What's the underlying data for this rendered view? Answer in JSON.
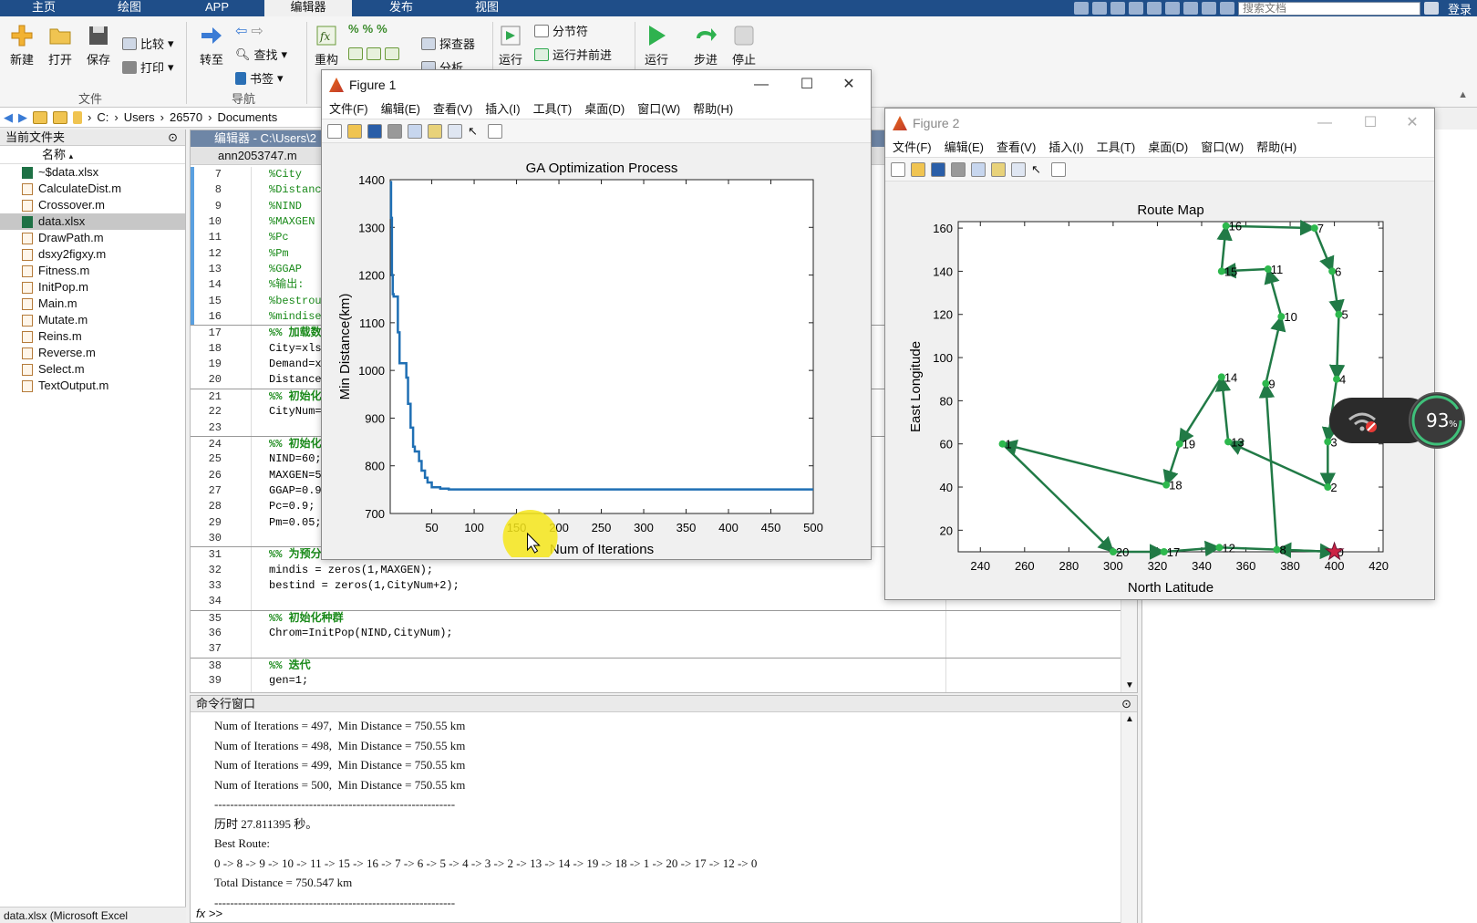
{
  "top_tabs": [
    {
      "label": "主页",
      "active": false
    },
    {
      "label": "绘图",
      "active": false
    },
    {
      "label": "APP",
      "active": false
    },
    {
      "label": "编辑器",
      "active": true
    },
    {
      "label": "发布",
      "active": false
    },
    {
      "label": "视图",
      "active": false
    }
  ],
  "search_placeholder": "搜索文档",
  "login_label": "登录",
  "ribbon": {
    "new_label": "新建",
    "open_label": "打开",
    "save_label": "保存",
    "compare_label": "比较",
    "print_label": "打印",
    "file_group": "文件",
    "goto_label": "转至",
    "find_label": "查找",
    "bookmark_label": "书签",
    "nav_group": "导航",
    "refactor_label": "重构",
    "analyzer_label": "探查器",
    "analyze_label": "分析",
    "run_section_label": "运行",
    "section_break_label": "分节符",
    "run_advance_label": "运行并前进",
    "run_label": "运行",
    "step_label": "步进",
    "stop_label": "停止"
  },
  "address": {
    "crumbs": [
      "C:",
      "Users",
      "26570",
      "Documents"
    ]
  },
  "file_panel": {
    "title": "当前文件夹",
    "col_name": "名称",
    "files": [
      {
        "name": "~$data.xlsx",
        "type": "xlsx",
        "selected": false
      },
      {
        "name": "CalculateDist.m",
        "type": "m",
        "selected": false
      },
      {
        "name": "Crossover.m",
        "type": "m",
        "selected": false
      },
      {
        "name": "data.xlsx",
        "type": "xlsx",
        "selected": true
      },
      {
        "name": "DrawPath.m",
        "type": "m",
        "selected": false
      },
      {
        "name": "dsxy2figxy.m",
        "type": "m",
        "selected": false
      },
      {
        "name": "Fitness.m",
        "type": "m",
        "selected": false
      },
      {
        "name": "InitPop.m",
        "type": "m",
        "selected": false
      },
      {
        "name": "Main.m",
        "type": "m",
        "selected": false
      },
      {
        "name": "Mutate.m",
        "type": "m",
        "selected": false
      },
      {
        "name": "Reins.m",
        "type": "m",
        "selected": false
      },
      {
        "name": "Reverse.m",
        "type": "m",
        "selected": false
      },
      {
        "name": "Select.m",
        "type": "m",
        "selected": false
      },
      {
        "name": "TextOutput.m",
        "type": "m",
        "selected": false
      }
    ],
    "bottom_label": "data.xlsx (Microsoft Excel"
  },
  "editor": {
    "title": "编辑器 - C:\\Users\\2",
    "tab": "ann2053747.m",
    "lines": [
      {
        "n": "7",
        "text": "%City",
        "kind": "c",
        "bar": true
      },
      {
        "n": "8",
        "text": "%Distanc",
        "kind": "c",
        "bar": true
      },
      {
        "n": "9",
        "text": "%NIND",
        "kind": "c",
        "bar": true
      },
      {
        "n": "10",
        "text": "%MAXGEN",
        "kind": "c",
        "bar": true
      },
      {
        "n": "11",
        "text": "%Pc",
        "kind": "c",
        "bar": true
      },
      {
        "n": "12",
        "text": "%Pm",
        "kind": "c",
        "bar": true
      },
      {
        "n": "13",
        "text": "%GGAP",
        "kind": "c",
        "bar": true
      },
      {
        "n": "14",
        "text": "%输出:",
        "kind": "c",
        "bar": true
      },
      {
        "n": "15",
        "text": "%bestrou",
        "kind": "c",
        "bar": true
      },
      {
        "n": "16",
        "text": "%mindise",
        "kind": "c",
        "bar": true
      },
      {
        "n": "17",
        "text": "%% 加载数",
        "kind": "s",
        "bar": false,
        "brk": true
      },
      {
        "n": "18",
        "text": "City=xls",
        "kind": "x",
        "bar": false
      },
      {
        "n": "19",
        "text": "Demand=x",
        "kind": "x",
        "bar": false
      },
      {
        "n": "20",
        "text": "Distance",
        "kind": "x",
        "bar": false
      },
      {
        "n": "21",
        "text": "%% 初始化",
        "kind": "s",
        "bar": false,
        "brk": true
      },
      {
        "n": "22",
        "text": "CityNum=",
        "kind": "x",
        "bar": false
      },
      {
        "n": "23",
        "text": "",
        "kind": "x",
        "bar": false
      },
      {
        "n": "24",
        "text": "%% 初始化",
        "kind": "s",
        "bar": false,
        "brk": true
      },
      {
        "n": "25",
        "text": "NIND=60;",
        "kind": "x",
        "bar": false
      },
      {
        "n": "26",
        "text": "MAXGEN=5",
        "kind": "x",
        "bar": false
      },
      {
        "n": "27",
        "text": "GGAP=0.9",
        "kind": "x",
        "bar": false
      },
      {
        "n": "28",
        "text": "Pc=0.9;",
        "kind": "x",
        "bar": false
      },
      {
        "n": "29",
        "text": "Pm=0.05;",
        "kind": "x",
        "bar": false
      },
      {
        "n": "30",
        "text": "",
        "kind": "x",
        "bar": false
      },
      {
        "n": "31",
        "text": "%% 为预分",
        "kind": "s",
        "bar": false,
        "brk": true
      },
      {
        "n": "32",
        "text": "mindis = zeros(1,MAXGEN);",
        "kind": "x",
        "bar": false
      },
      {
        "n": "33",
        "text": "bestind = zeros(1,CityNum+2);",
        "kind": "x",
        "bar": false
      },
      {
        "n": "34",
        "text": "",
        "kind": "x",
        "bar": false
      },
      {
        "n": "35",
        "text": "%% 初始化种群",
        "kind": "s",
        "bar": false,
        "brk": true
      },
      {
        "n": "36",
        "text": "Chrom=InitPop(NIND,CityNum);",
        "kind": "x",
        "bar": false
      },
      {
        "n": "37",
        "text": "",
        "kind": "x",
        "bar": false
      },
      {
        "n": "38",
        "text": "%% 迭代",
        "kind": "s",
        "bar": false,
        "brk": true
      },
      {
        "n": "39",
        "text": "gen=1;",
        "kind": "x",
        "bar": false
      }
    ]
  },
  "command_window": {
    "title": "命令行窗口",
    "lines": [
      "Num of Iterations = 497,  Min Distance = 750.55 km",
      "Num of Iterations = 498,  Min Distance = 750.55 km",
      "Num of Iterations = 499,  Min Distance = 750.55 km",
      "Num of Iterations = 500,  Min Distance = 750.55 km",
      "-------------------------------------------------------------",
      "历时 27.811395 秒。",
      "Best Route:",
      "0 -> 8 -> 9 -> 10 -> 11 -> 15 -> 16 -> 7 -> 6 -> 5 -> 4 -> 3 -> 2 -> 13 -> 14 -> 19 -> 18 -> 1 -> 20 -> 17 -> 12 -> 0",
      "Total Distance = 750.547 km",
      "-------------------------------------------------------------"
    ],
    "prompt": "fx >>"
  },
  "figure1": {
    "title": "Figure 1",
    "menu": [
      "文件(F)",
      "编辑(E)",
      "查看(V)",
      "插入(I)",
      "工具(T)",
      "桌面(D)",
      "窗口(W)",
      "帮助(H)"
    ]
  },
  "figure2": {
    "title": "Figure 2",
    "menu": [
      "文件(F)",
      "编辑(E)",
      "查看(V)",
      "插入(I)",
      "工具(T)",
      "桌面(D)",
      "窗口(W)",
      "帮助(H)"
    ]
  },
  "net_widget": {
    "percent": "93",
    "unit": "%"
  },
  "chart_data": [
    {
      "type": "line",
      "title": "GA Optimization Process",
      "xlabel": "Num of Iterations",
      "ylabel": "Min Distance(km)",
      "xlim": [
        1,
        500
      ],
      "ylim": [
        700,
        1400
      ],
      "xticks": [
        50,
        100,
        150,
        200,
        250,
        300,
        350,
        400,
        450,
        500
      ],
      "yticks": [
        700,
        800,
        900,
        1000,
        1100,
        1200,
        1300,
        1400
      ],
      "color": "#1f6fb4",
      "x": [
        1,
        2,
        3,
        4,
        5,
        6,
        8,
        10,
        12,
        14,
        17,
        20,
        22,
        25,
        28,
        30,
        35,
        38,
        42,
        45,
        50,
        60,
        70,
        500
      ],
      "y": [
        1395,
        1320,
        1200,
        1160,
        1155,
        1155,
        1155,
        1080,
        1015,
        1015,
        1015,
        985,
        930,
        880,
        840,
        830,
        810,
        790,
        775,
        765,
        755,
        752,
        750.55,
        750.55
      ],
      "grid": false
    },
    {
      "type": "scatter",
      "title": "Route Map",
      "xlabel": "North Latitude",
      "ylabel": "East Longitude",
      "xlim": [
        230,
        422
      ],
      "ylim": [
        10,
        163
      ],
      "xticks": [
        240,
        260,
        280,
        300,
        320,
        340,
        360,
        380,
        400,
        420
      ],
      "yticks": [
        20,
        40,
        60,
        80,
        100,
        120,
        140,
        160
      ],
      "points": [
        {
          "id": "0",
          "x": 400,
          "y": 10
        },
        {
          "id": "1",
          "x": 250,
          "y": 60
        },
        {
          "id": "2",
          "x": 397,
          "y": 40
        },
        {
          "id": "3",
          "x": 397,
          "y": 61
        },
        {
          "id": "4",
          "x": 401,
          "y": 90
        },
        {
          "id": "5",
          "x": 402,
          "y": 120
        },
        {
          "id": "6",
          "x": 399,
          "y": 140
        },
        {
          "id": "7",
          "x": 391,
          "y": 160
        },
        {
          "id": "8",
          "x": 374,
          "y": 11
        },
        {
          "id": "9",
          "x": 369,
          "y": 88
        },
        {
          "id": "10",
          "x": 376,
          "y": 119
        },
        {
          "id": "11",
          "x": 370,
          "y": 141
        },
        {
          "id": "12",
          "x": 348,
          "y": 12
        },
        {
          "id": "13",
          "x": 352,
          "y": 61
        },
        {
          "id": "14",
          "x": 349,
          "y": 91
        },
        {
          "id": "15",
          "x": 349,
          "y": 140
        },
        {
          "id": "16",
          "x": 351,
          "y": 161
        },
        {
          "id": "17",
          "x": 323,
          "y": 10
        },
        {
          "id": "18",
          "x": 324,
          "y": 41
        },
        {
          "id": "19",
          "x": 330,
          "y": 60
        },
        {
          "id": "20",
          "x": 300,
          "y": 10
        }
      ],
      "route": [
        "0",
        "8",
        "9",
        "10",
        "11",
        "15",
        "16",
        "7",
        "6",
        "5",
        "4",
        "3",
        "2",
        "13",
        "14",
        "19",
        "18",
        "1",
        "20",
        "17",
        "12",
        "0"
      ],
      "line_color": "#217a46",
      "point_color": "#2db84d",
      "start_marker_color": "#cc2244"
    }
  ]
}
